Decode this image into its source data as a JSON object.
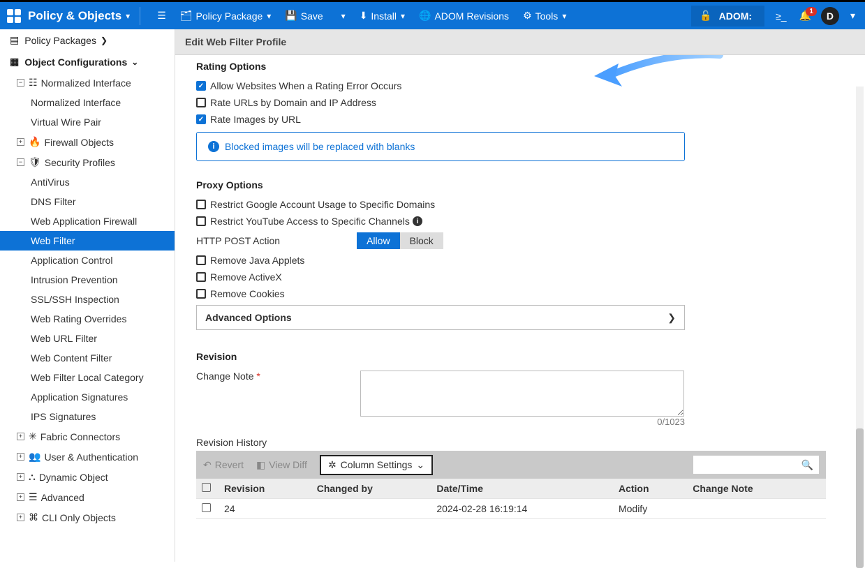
{
  "topbar": {
    "brand": "Policy & Objects",
    "policy_package": "Policy Package",
    "save": "Save",
    "install": "Install",
    "adom_revisions": "ADOM Revisions",
    "tools": "Tools",
    "adom_label": "ADOM:",
    "adom_value": "",
    "notif_count": "1",
    "avatar_initial": "D"
  },
  "sidebar": {
    "policy_packages": "Policy Packages",
    "object_config": "Object Configurations",
    "normalized_interface_group": "Normalized Interface",
    "normalized_interface": "Normalized Interface",
    "virtual_wire_pair": "Virtual Wire Pair",
    "firewall_objects": "Firewall Objects",
    "security_profiles": "Security Profiles",
    "antivirus": "AntiVirus",
    "dns_filter": "DNS Filter",
    "waf": "Web Application Firewall",
    "web_filter": "Web Filter",
    "app_control": "Application Control",
    "intrusion": "Intrusion Prevention",
    "ssl": "SSL/SSH Inspection",
    "web_rating": "Web Rating Overrides",
    "web_url": "Web URL Filter",
    "web_content": "Web Content Filter",
    "web_filter_local": "Web Filter Local Category",
    "app_sigs": "Application Signatures",
    "ips_sigs": "IPS Signatures",
    "fabric": "Fabric Connectors",
    "user_auth": "User & Authentication",
    "dynamic": "Dynamic Object",
    "advanced": "Advanced",
    "cli_only": "CLI Only Objects"
  },
  "content": {
    "header": "Edit Web Filter Profile",
    "rating_options": "Rating Options",
    "allow_rating_error": "Allow Websites When a Rating Error Occurs",
    "rate_urls_domain": "Rate URLs by Domain and IP Address",
    "rate_images": "Rate Images by URL",
    "info_msg": "Blocked images will be replaced with blanks",
    "proxy_options": "Proxy Options",
    "restrict_google": "Restrict Google Account Usage to Specific Domains",
    "restrict_youtube": "Restrict YouTube Access to Specific Channels",
    "http_post": "HTTP POST Action",
    "allow": "Allow",
    "block": "Block",
    "remove_java": "Remove Java Applets",
    "remove_activex": "Remove ActiveX",
    "remove_cookies": "Remove Cookies",
    "adv_options": "Advanced Options",
    "revision": "Revision",
    "change_note": "Change Note",
    "char_count": "0/1023",
    "revision_history": "Revision History",
    "revert": "Revert",
    "view_diff": "View Diff",
    "column_settings": "Column Settings",
    "table": {
      "col_revision": "Revision",
      "col_changed_by": "Changed by",
      "col_datetime": "Date/Time",
      "col_action": "Action",
      "col_change_note": "Change Note",
      "rows": [
        {
          "revision": "24",
          "changed_by": "",
          "datetime": "2024-02-28 16:19:14",
          "action": "Modify",
          "note": ""
        }
      ]
    }
  }
}
